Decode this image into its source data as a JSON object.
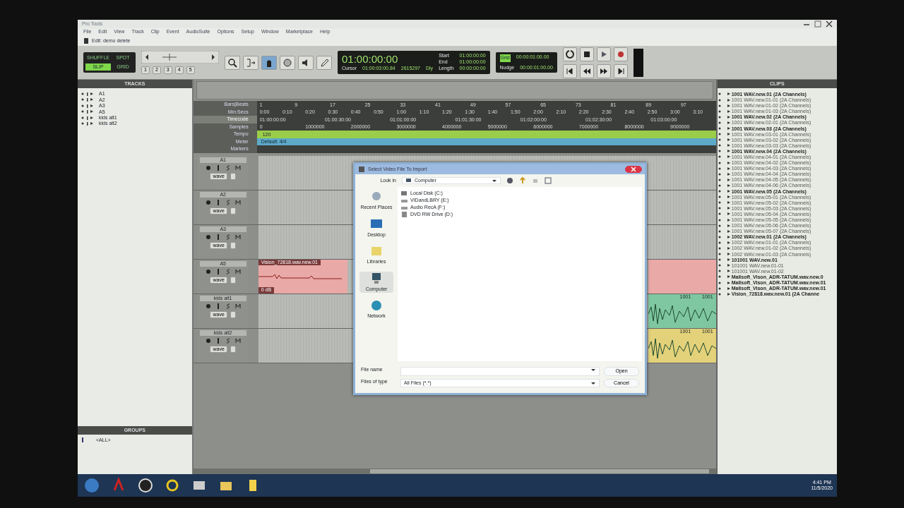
{
  "app_title": "Pro Tools",
  "menu": [
    "File",
    "Edit",
    "View",
    "Track",
    "Clip",
    "Event",
    "AudioSuite",
    "Options",
    "Setup",
    "Window",
    "Marketplace",
    "Help"
  ],
  "edit_window": {
    "title": "Edit: demo delete"
  },
  "toolbar": {
    "modes": [
      {
        "label": "SHUFFLE",
        "selected": false
      },
      {
        "label": "SPOT",
        "selected": false
      },
      {
        "label": "SLIP",
        "selected": true
      },
      {
        "label": "GRID",
        "selected": false
      }
    ],
    "zoom_presets": [
      "1",
      "2",
      "3",
      "4",
      "5"
    ],
    "tools": [
      {
        "kind": "zoom",
        "selected": false
      },
      {
        "kind": "trim",
        "selected": false
      },
      {
        "kind": "grabber",
        "selected": true
      },
      {
        "kind": "scrub",
        "selected": false
      },
      {
        "kind": "speaker",
        "selected": false
      },
      {
        "kind": "pencil",
        "selected": false
      }
    ],
    "main_counter": "01:00:00:00",
    "selection": [
      {
        "label": "Start",
        "value": "01:00:00:00"
      },
      {
        "label": "End",
        "value": "01:00:00:00"
      },
      {
        "label": "Length",
        "value": "00:00:00:00"
      }
    ],
    "cursor": {
      "label": "Cursor",
      "value": "01:00:03:00.84"
    },
    "sample_readout": "2615297",
    "delay": "Dly",
    "grid": {
      "label": "Grid",
      "value": "00:00:01:00.00",
      "on": true
    },
    "nudge": {
      "label": "Nudge",
      "value": "00:00:01:00.00"
    }
  },
  "tracks_panel": {
    "title": "TRACKS",
    "items": [
      "A1",
      "A2",
      "A3",
      "A5",
      "kids alt1",
      "kids alt2"
    ]
  },
  "groups_panel": {
    "title": "GROUPS",
    "items": [
      "<ALL>"
    ]
  },
  "rulers": [
    {
      "name": "Bars|Beats",
      "selected": false,
      "labels": [
        "1",
        "9",
        "17",
        "25",
        "33",
        "41",
        "49",
        "57",
        "65",
        "73",
        "81",
        "89",
        "97"
      ]
    },
    {
      "name": "Min:Secs",
      "selected": false,
      "labels": [
        "0:00",
        "0:10",
        "0:20",
        "0:30",
        "0:40",
        "0:50",
        "1:00",
        "1:10",
        "1:20",
        "1:30",
        "1:40",
        "1:50",
        "2:00",
        "2:10",
        "2:20",
        "2:30",
        "2:40",
        "2:50",
        "3:00",
        "3:10"
      ]
    },
    {
      "name": "Timecode",
      "selected": true,
      "labels": [
        "01:00:00:00",
        "01:00:30:00",
        "01:01:00:00",
        "01:01:30:00",
        "01:02:00:00",
        "01:02:30:00",
        "01:03:00:00"
      ]
    },
    {
      "name": "Samples",
      "selected": false,
      "labels": [
        "0",
        "1000000",
        "2000000",
        "3000000",
        "4000000",
        "5000000",
        "6000000",
        "7000000",
        "8000000",
        "9000000"
      ]
    },
    {
      "name": "Tempo",
      "selected": false,
      "kind": "tempo",
      "labels": [
        "120"
      ]
    },
    {
      "name": "Meter",
      "selected": false,
      "kind": "meter",
      "labels": [
        "Default: 4/4"
      ]
    },
    {
      "name": "Markers",
      "selected": false
    }
  ],
  "tracks": [
    {
      "name": "A1",
      "mode": "wave"
    },
    {
      "name": "A2",
      "mode": "wave"
    },
    {
      "name": "A3",
      "mode": "wave"
    },
    {
      "name": "A5",
      "mode": "wave",
      "clip": {
        "name": "Vision_72818.wav.new.01",
        "gain": "0 dB",
        "color": "#e9a9a6"
      }
    },
    {
      "name": "kids alt1",
      "mode": "wave",
      "clip": {
        "labels": [
          "1001",
          "1001"
        ],
        "color": "#7fc7a0"
      }
    },
    {
      "name": "kids alt2",
      "mode": "wave",
      "clip": {
        "labels": [
          "1001",
          "1001"
        ],
        "color": "#e3d27a"
      }
    }
  ],
  "dialog": {
    "title": "Select Video File To Import",
    "look_in": {
      "label": "Look in",
      "value": "Computer"
    },
    "places": [
      {
        "label": "Recent Places",
        "selected": false
      },
      {
        "label": "Desktop",
        "selected": false
      },
      {
        "label": "Libraries",
        "selected": false
      },
      {
        "label": "Computer",
        "selected": true
      },
      {
        "label": "Network",
        "selected": false
      }
    ],
    "items": [
      {
        "label": "Local Disk (C:)",
        "kind": "disk"
      },
      {
        "label": "VIDandLBRY (E:)",
        "kind": "drive"
      },
      {
        "label": "Audio RecA (F:)",
        "kind": "drive"
      },
      {
        "label": "DVD RW Drive (D:)",
        "kind": "dvd"
      }
    ],
    "file_name": {
      "label": "File name"
    },
    "file_type": {
      "label": "Files of type",
      "value": "All Files (*.*)"
    },
    "buttons": [
      "Open",
      "Cancel"
    ]
  },
  "clips_panel": {
    "title": "CLIPS",
    "items": [
      {
        "label": "1001 WAV.new.01  (2A Channels)",
        "kind": "whole"
      },
      {
        "label": "1001 WAV.new.01-01  (2A Channels)",
        "kind": "sub"
      },
      {
        "label": "1001 WAV.new.01-02  (2A Channels)",
        "kind": "sub"
      },
      {
        "label": "1001 WAV.new.01-03  (2A Channels)",
        "kind": "sub"
      },
      {
        "label": "1001 WAV.new.02  (2A Channels)",
        "kind": "whole"
      },
      {
        "label": "1001 WAV.new.02-01  (2A Channels)",
        "kind": "sub"
      },
      {
        "label": "1001 WAV.new.03  (2A Channels)",
        "kind": "whole"
      },
      {
        "label": "1001 WAV.new.03-01  (2A Channels)",
        "kind": "sub"
      },
      {
        "label": "1001 WAV.new.03-02  (2A Channels)",
        "kind": "sub"
      },
      {
        "label": "1001 WAV.new.03-03  (2A Channels)",
        "kind": "sub"
      },
      {
        "label": "1001 WAV.new.04  (2A Channels)",
        "kind": "whole"
      },
      {
        "label": "1001 WAV.new.04-01  (2A Channels)",
        "kind": "sub"
      },
      {
        "label": "1001 WAV.new.04-02  (2A Channels)",
        "kind": "sub"
      },
      {
        "label": "1001 WAV.new.04-03  (2A Channels)",
        "kind": "sub"
      },
      {
        "label": "1001 WAV.new.04-04  (2A Channels)",
        "kind": "sub"
      },
      {
        "label": "1001 WAV.new.04-05  (2A Channels)",
        "kind": "sub"
      },
      {
        "label": "1001 WAV.new.04-06  (2A Channels)",
        "kind": "sub"
      },
      {
        "label": "1001 WAV.new.05  (2A Channels)",
        "kind": "whole"
      },
      {
        "label": "1001 WAV.new.05-01  (2A Channels)",
        "kind": "sub"
      },
      {
        "label": "1001 WAV.new.05-02  (2A Channels)",
        "kind": "sub"
      },
      {
        "label": "1001 WAV.new.05-03  (2A Channels)",
        "kind": "sub"
      },
      {
        "label": "1001 WAV.new.05-04  (2A Channels)",
        "kind": "sub"
      },
      {
        "label": "1001 WAV.new.05-05  (2A Channels)",
        "kind": "sub"
      },
      {
        "label": "1001 WAV.new.05-06  (2A Channels)",
        "kind": "sub"
      },
      {
        "label": "1001 WAV.new.05-07  (2A Channels)",
        "kind": "sub"
      },
      {
        "label": "1002 WAV.new.01  (2A Channels)",
        "kind": "whole"
      },
      {
        "label": "1002 WAV.new.01-01  (2A Channels)",
        "kind": "sub"
      },
      {
        "label": "1002 WAV.new.01-02  (2A Channels)",
        "kind": "sub"
      },
      {
        "label": "1002 WAV.new.01-03  (2A Channels)",
        "kind": "sub"
      },
      {
        "label": "101001 WAV.new.01",
        "kind": "whole"
      },
      {
        "label": "101001 WAV.new.01-01",
        "kind": "sub"
      },
      {
        "label": "101001 WAV.new.01-02",
        "kind": "sub"
      },
      {
        "label": "Mallsoft_Vison_ADR-TATUM.wav.new.0",
        "kind": "whole"
      },
      {
        "label": "Mallsoft_Vison_ADR-TATUM.wav.new.01",
        "kind": "whole"
      },
      {
        "label": "Mallsoft_Vison_ADR-TATUM.wav.new.01",
        "kind": "whole"
      },
      {
        "label": "Vision_72818.wav.new.01  (2A Channe",
        "kind": "whole"
      }
    ]
  },
  "taskbar": {
    "time": "4:41 PM",
    "date": "11/5/2020"
  }
}
